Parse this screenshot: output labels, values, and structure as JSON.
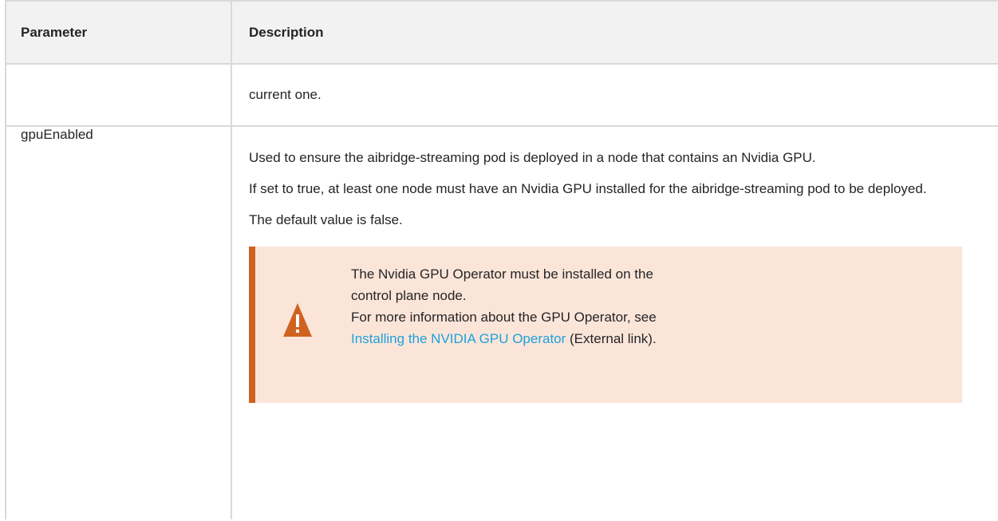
{
  "table": {
    "headers": {
      "parameter": "Parameter",
      "description": "Description"
    },
    "rows": [
      {
        "parameter": "",
        "description": "current one."
      },
      {
        "parameter": "gpuEnabled",
        "paragraphs": [
          "Used to ensure the aibridge-streaming pod is deployed in a node that contains an Nvidia GPU.",
          "If set to true, at least one node must have an Nvidia GPU installed for the aibridge-streaming pod to be deployed.",
          "The default value is false."
        ],
        "note": {
          "icon": "warning-icon",
          "line1": "The Nvidia GPU Operator must be installed on the control plane node.",
          "line2": "For more information about the GPU Operator, see",
          "link_text": "Installing the NVIDIA GPU Operator",
          "link_suffix": " (External link)."
        }
      }
    ]
  },
  "colors": {
    "header_bg": "#f2f2f2",
    "border": "#d9d9d9",
    "callout_bg": "#fbe5d9",
    "callout_accent": "#d0621f",
    "link": "#1ea1dc"
  }
}
